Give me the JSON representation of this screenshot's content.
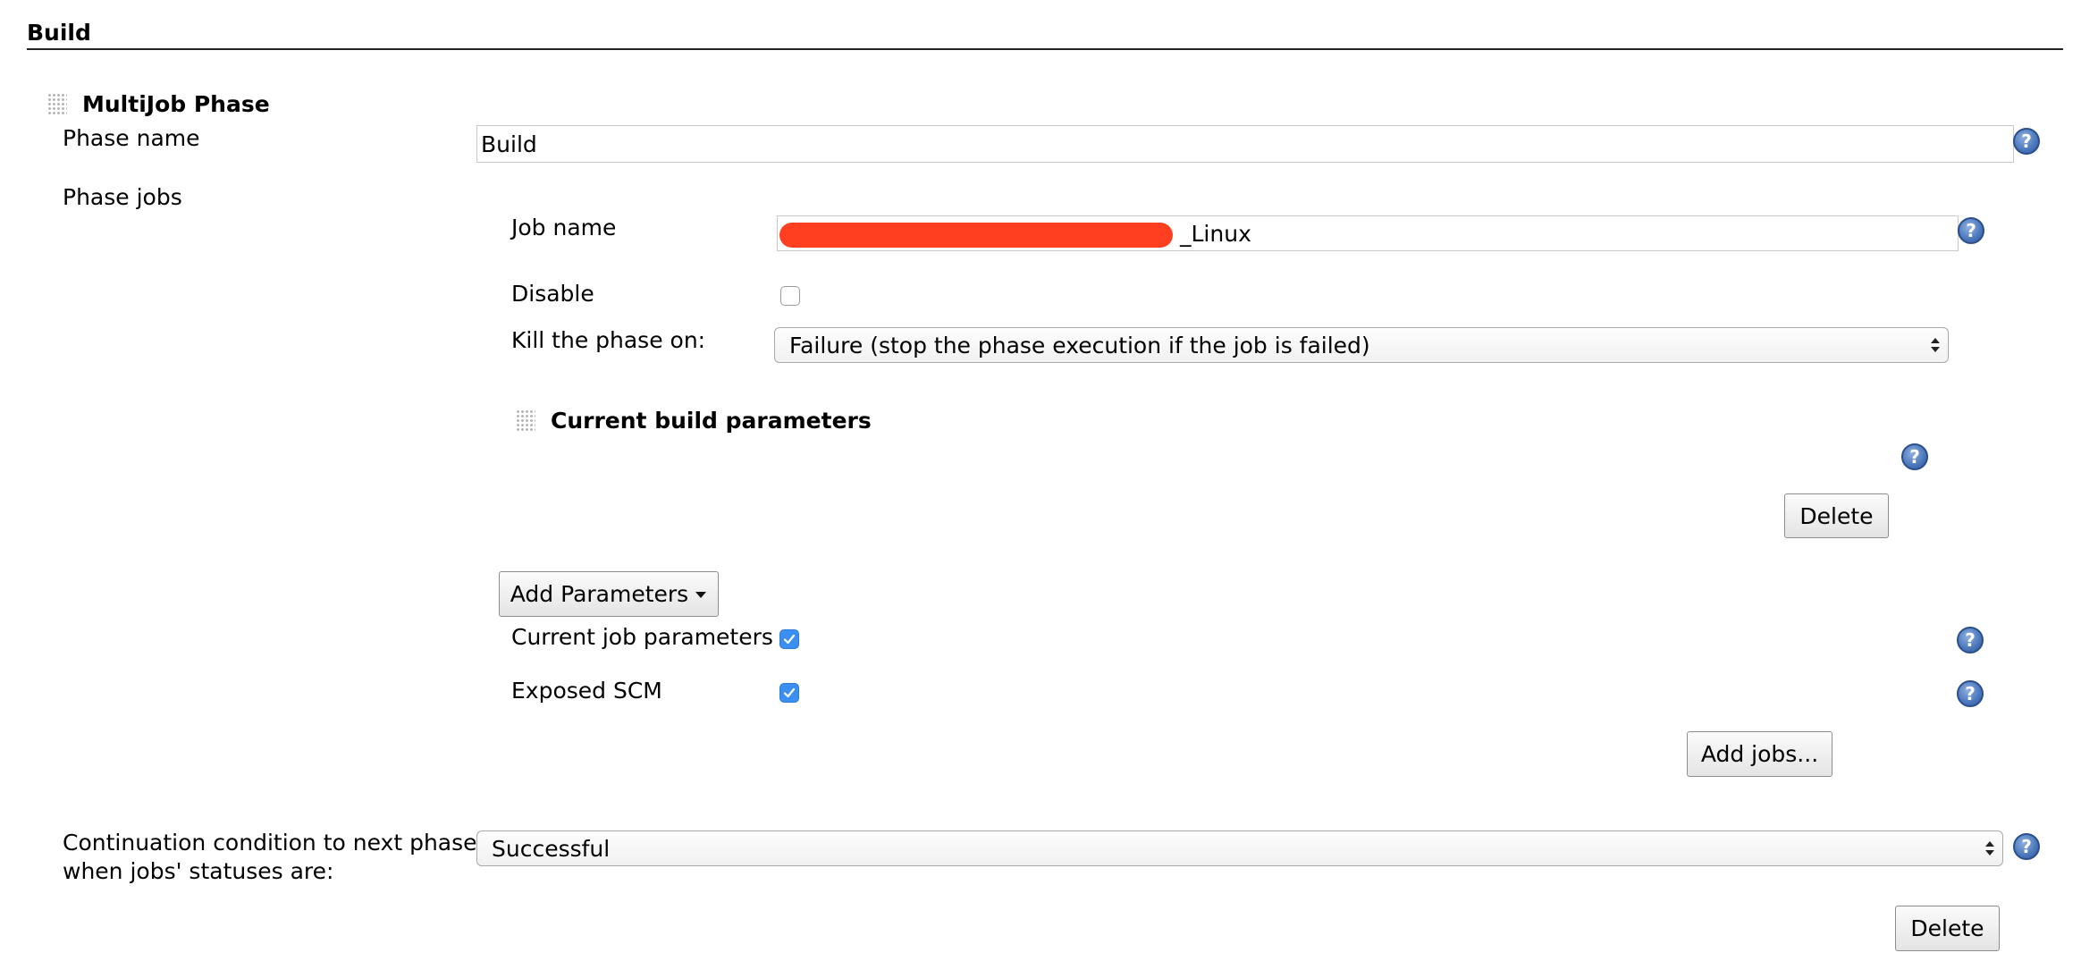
{
  "section": {
    "title": "Build"
  },
  "phase": {
    "block_title": "MultiJob Phase",
    "name_label": "Phase name",
    "name_value": "Build",
    "jobs_label": "Phase jobs",
    "continuation_label_line1": "Continuation condition to next phase",
    "continuation_label_line2": "when jobs' statuses are:",
    "continuation_value": "Successful",
    "delete_label": "Delete"
  },
  "job": {
    "name_label": "Job name",
    "name_value": "_Linux",
    "disable_label": "Disable",
    "disable_checked": false,
    "kill_label": "Kill the phase on:",
    "kill_value": "Failure (stop the phase execution if the job is failed)",
    "params_block_title": "Current build parameters",
    "params_delete_label": "Delete",
    "add_params_label": "Add Parameters",
    "current_job_params_label": "Current job parameters",
    "current_job_params_checked": true,
    "exposed_scm_label": "Exposed SCM",
    "exposed_scm_checked": true,
    "add_jobs_label": "Add jobs..."
  },
  "icons": {
    "help": "help-icon",
    "grip": "drag-handle-icon",
    "check": "check-icon",
    "dropdown": "caret-down-icon"
  },
  "colors": {
    "accent": "#3b8ff0",
    "redaction": "#ff3f1f",
    "help_blue": "#4f7bbf"
  }
}
